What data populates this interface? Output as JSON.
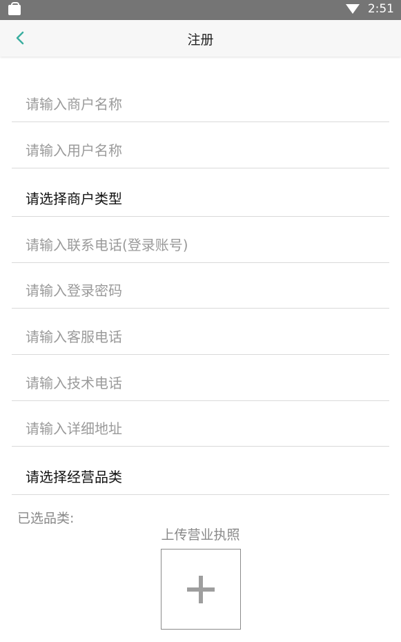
{
  "status_bar": {
    "time": "2:51"
  },
  "header": {
    "title": "注册",
    "back_icon": "chevron-left-icon"
  },
  "fields": [
    {
      "text": "请输入商户名称",
      "kind": "input"
    },
    {
      "text": "请输入用户名称",
      "kind": "input"
    },
    {
      "text": "请选择商户类型",
      "kind": "select"
    },
    {
      "text": "请输入联系电话(登录账号)",
      "kind": "input"
    },
    {
      "text": "请输入登录密码",
      "kind": "input"
    },
    {
      "text": "请输入客服电话",
      "kind": "input"
    },
    {
      "text": "请输入技术电话",
      "kind": "input"
    },
    {
      "text": "请输入详细地址",
      "kind": "input"
    },
    {
      "text": "请选择经营品类",
      "kind": "select"
    }
  ],
  "selected_categories_label": "已选品类:",
  "upload": {
    "label": "上传营业执照",
    "icon": "plus-icon"
  },
  "colors": {
    "accent": "#3aaea0",
    "status_bar": "#757575",
    "placeholder": "#9a9a9a"
  }
}
